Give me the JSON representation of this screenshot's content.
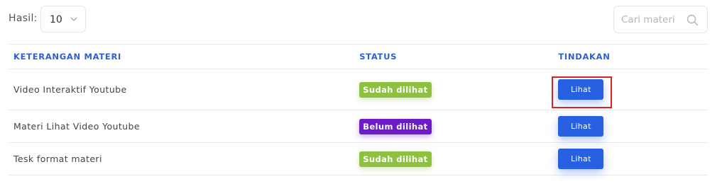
{
  "toolbar": {
    "hasil_label": "Hasil:",
    "page_size": {
      "selected": "10"
    },
    "search": {
      "placeholder": "Cari materi",
      "value": ""
    }
  },
  "table": {
    "headers": [
      "KETERANGAN MATERI",
      "STATUS",
      "TINDAKAN"
    ],
    "rows": [
      {
        "title": "Video Interaktif Youtube",
        "status": "Sudah dilihat",
        "status_type": "seen",
        "action": "Lihat"
      },
      {
        "title": "Materi Lihat Video Youtube",
        "status": "Belum dilihat",
        "status_type": "unseen",
        "action": "Lihat"
      },
      {
        "title": "Tesk format materi",
        "status": "Sudah dilihat",
        "status_type": "seen",
        "action": "Lihat"
      }
    ]
  },
  "colors": {
    "accent": "#2761e2",
    "header_text": "#2f5fd7",
    "status_seen": "#8dc13f",
    "status_unseen": "#6b1bc7",
    "highlight": "#e01e1e"
  },
  "icons": {
    "select": "chevron-down-icon",
    "search": "search-icon"
  }
}
